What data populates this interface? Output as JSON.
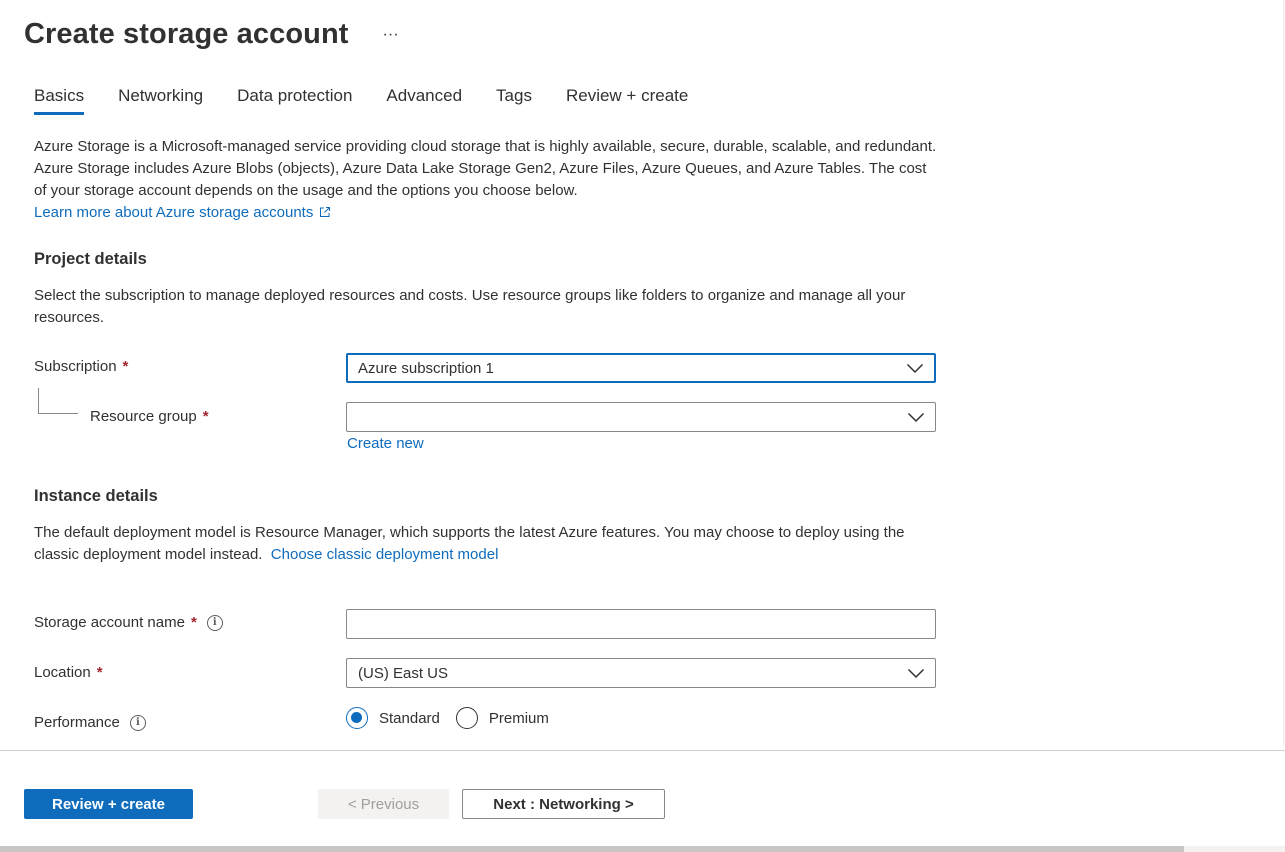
{
  "header": {
    "title": "Create storage account",
    "more": "···"
  },
  "tabs": [
    {
      "label": "Basics",
      "active": true
    },
    {
      "label": "Networking",
      "active": false
    },
    {
      "label": "Data protection",
      "active": false
    },
    {
      "label": "Advanced",
      "active": false
    },
    {
      "label": "Tags",
      "active": false
    },
    {
      "label": "Review + create",
      "active": false
    }
  ],
  "intro": {
    "text": "Azure Storage is a Microsoft-managed service providing cloud storage that is highly available, secure, durable, scalable, and redundant. Azure Storage includes Azure Blobs (objects), Azure Data Lake Storage Gen2, Azure Files, Azure Queues, and Azure Tables. The cost of your storage account depends on the usage and the options you choose below.",
    "link": "Learn more about Azure storage accounts"
  },
  "project": {
    "title": "Project details",
    "description": "Select the subscription to manage deployed resources and costs. Use resource groups like folders to organize and manage all your resources.",
    "subscription_label": "Subscription",
    "subscription_value": "Azure subscription 1",
    "resource_group_label": "Resource group",
    "resource_group_value": "",
    "create_new": "Create new"
  },
  "instance": {
    "title": "Instance details",
    "description": "The default deployment model is Resource Manager, which supports the latest Azure features. You may choose to deploy using the classic deployment model instead.",
    "classic_link": "Choose classic deployment model",
    "name_label": "Storage account name",
    "name_value": "",
    "location_label": "Location",
    "location_value": "(US) East US",
    "performance_label": "Performance",
    "performance_options": [
      {
        "label": "Standard",
        "selected": true
      },
      {
        "label": "Premium",
        "selected": false
      }
    ]
  },
  "required_mark": "*",
  "info_glyph": "i",
  "footer": {
    "review_create": "Review + create",
    "previous": "< Previous",
    "next": "Next : Networking >"
  },
  "colors": {
    "accent": "#0f6cbd",
    "required": "#a4262c",
    "text": "#323130"
  }
}
